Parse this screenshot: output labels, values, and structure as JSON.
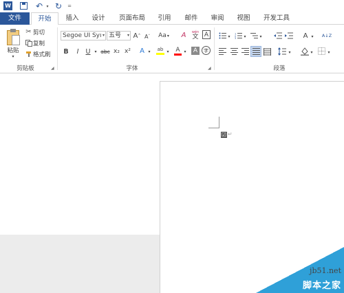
{
  "app": {
    "icon_letter": "W"
  },
  "qat": {
    "undo_symbol": "↶",
    "redo_symbol": "↻",
    "dropdown_symbol": "▾",
    "customize_symbol": "="
  },
  "tabs": [
    {
      "label": "文件"
    },
    {
      "label": "开始"
    },
    {
      "label": "插入"
    },
    {
      "label": "设计"
    },
    {
      "label": "页面布局"
    },
    {
      "label": "引用"
    },
    {
      "label": "邮件"
    },
    {
      "label": "审阅"
    },
    {
      "label": "视图"
    },
    {
      "label": "开发工具"
    }
  ],
  "clipboard": {
    "paste_label": "粘贴",
    "cut_label": "剪切",
    "copy_label": "复制",
    "format_painter_label": "格式刷",
    "group_label": "剪贴板"
  },
  "font": {
    "font_name": "Segoe UI Syı",
    "font_size": "五号",
    "grow": "A",
    "shrink": "A",
    "case": "Aa",
    "clear_format": "A",
    "phonetic": "wén",
    "phonetic_char": "文",
    "border_char": "A",
    "bold": "B",
    "italic": "I",
    "underline": "U",
    "strikethrough": "abc",
    "subscript": "x₂",
    "superscript": "x²",
    "text_effects": "A",
    "highlight": "ab",
    "font_color": "A",
    "char_shading": "A",
    "enclose_char": "字",
    "group_label": "字体"
  },
  "paragraph": {
    "group_label": "段落",
    "sort_symbol": "A↓Z",
    "chinese_layout": "A"
  },
  "colors": {
    "brand": "#2b579a",
    "highlight_yellow": "#ffff00",
    "font_red": "#ff0000",
    "watermark_blue": "#2fa0d8"
  },
  "document": {
    "checkbox_symbol": "☑",
    "paragraph_mark": "↵"
  },
  "watermark": {
    "url": "jb51.net",
    "text": "脚本之家"
  }
}
